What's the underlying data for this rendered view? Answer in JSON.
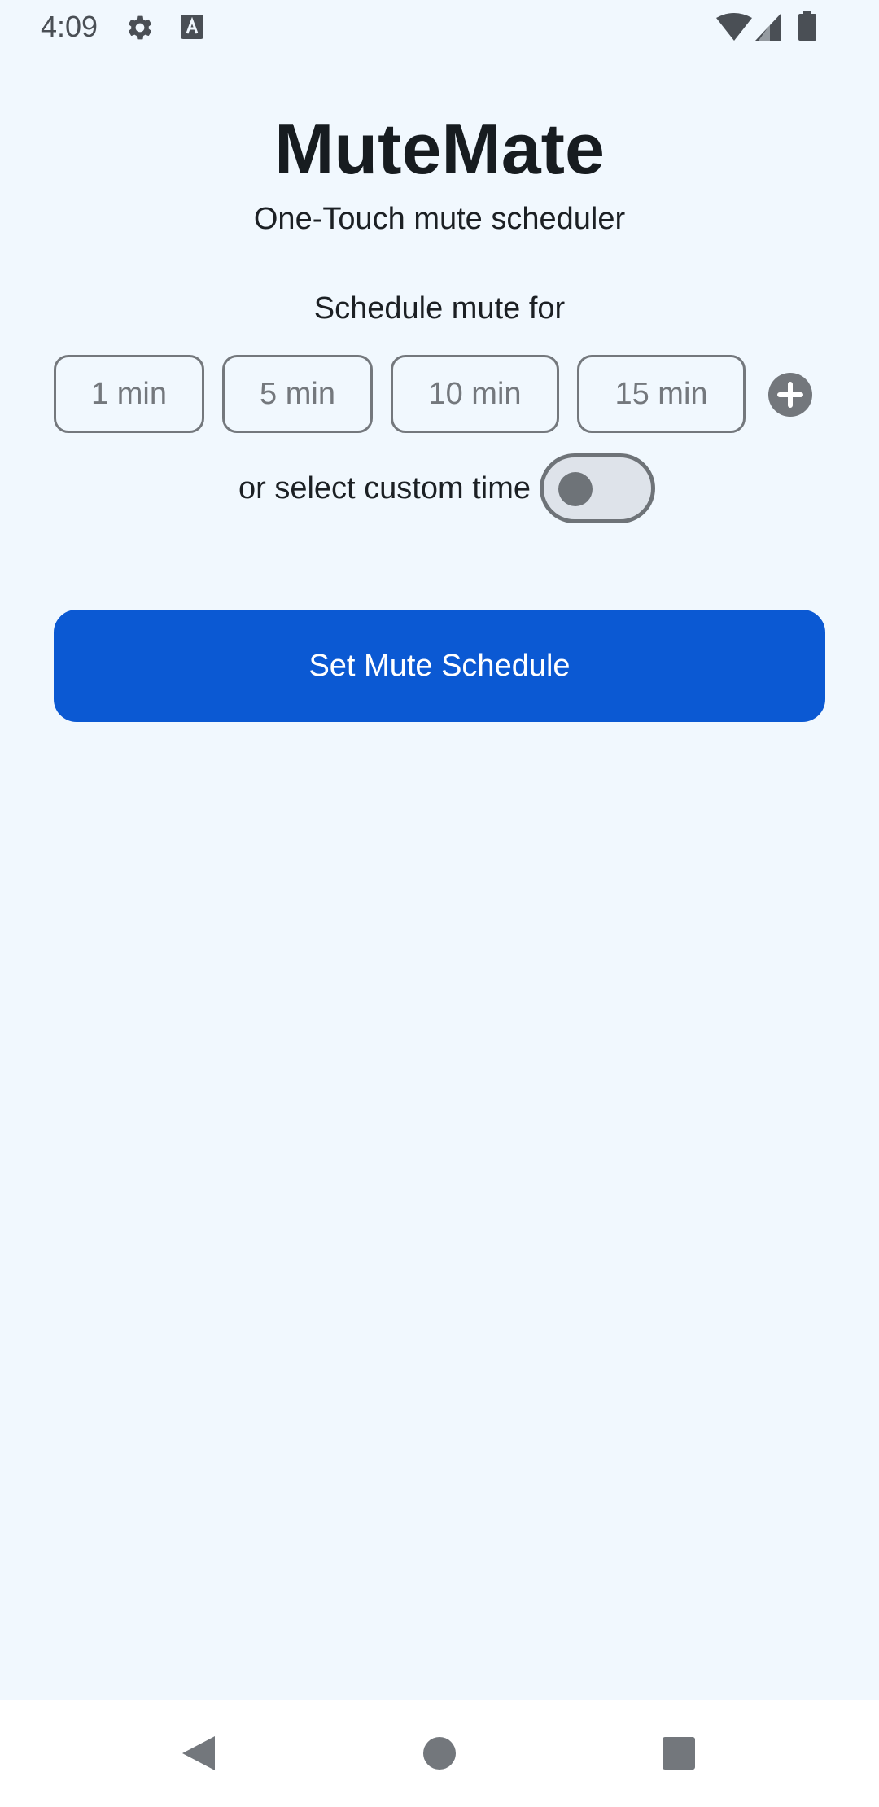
{
  "status_bar": {
    "time": "4:09",
    "icons": [
      "settings-icon",
      "text-a-icon",
      "wifi-icon",
      "cell-signal-icon",
      "battery-icon"
    ]
  },
  "app": {
    "title": "MuteMate",
    "subtitle": "One-Touch mute scheduler"
  },
  "schedule": {
    "label": "Schedule mute for",
    "options": [
      "1 min",
      "5 min",
      "10 min",
      "15 min"
    ],
    "add_icon": "plus-circle-icon",
    "custom_label": "or select custom time",
    "custom_toggle_on": false
  },
  "primary_button": {
    "label": "Set Mute Schedule"
  },
  "nav_bar": {
    "icons": [
      "back-icon",
      "home-icon",
      "recents-icon"
    ]
  },
  "colors": {
    "background": "#F1F8FE",
    "accent": "#0B59D3",
    "outline": "#74787D"
  }
}
